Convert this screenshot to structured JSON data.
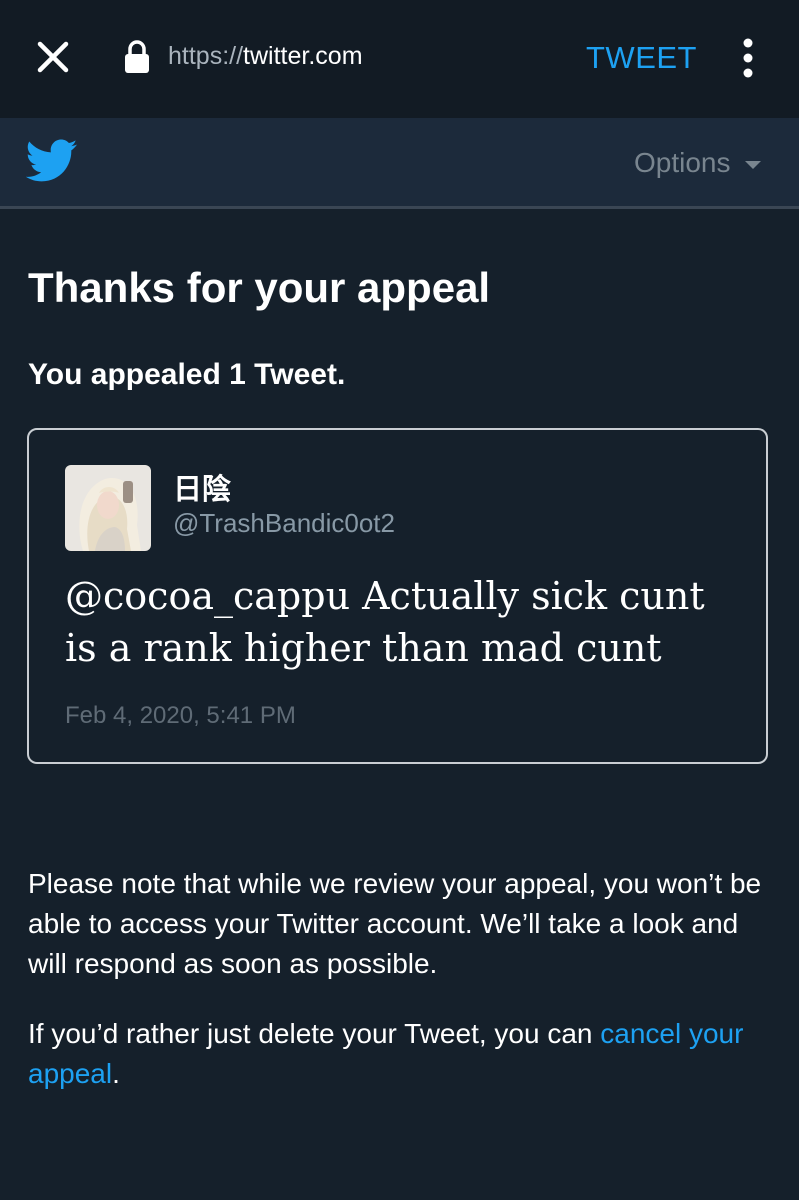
{
  "browser": {
    "url_scheme": "https://",
    "url_host": "twitter.com",
    "action_label": "TWEET"
  },
  "appbar": {
    "options_label": "Options"
  },
  "page": {
    "title": "Thanks for your appeal",
    "subtitle": "You appealed 1 Tweet."
  },
  "tweet": {
    "author_name": "日陰",
    "author_handle": "@TrashBandic0ot2",
    "text": "@cocoa_cappu Actually sick cunt is a rank higher than mad cunt",
    "date": "Feb 4, 2020, 5:41 PM"
  },
  "notice": {
    "review_text": "Please note that while we review your appeal, you won’t be able to access your Twitter account. We’ll take a look and will respond as soon as possible.",
    "delete_prefix": "If you’d rather just delete your Tweet, you can ",
    "cancel_link": "cancel your appeal",
    "delete_suffix": "."
  },
  "colors": {
    "background": "#15202b",
    "accent": "#1da1f2",
    "muted": "#8899a6"
  },
  "icons": [
    "close-icon",
    "lock-icon",
    "more-options-icon",
    "twitter-bird-icon",
    "chevron-down-icon"
  ]
}
